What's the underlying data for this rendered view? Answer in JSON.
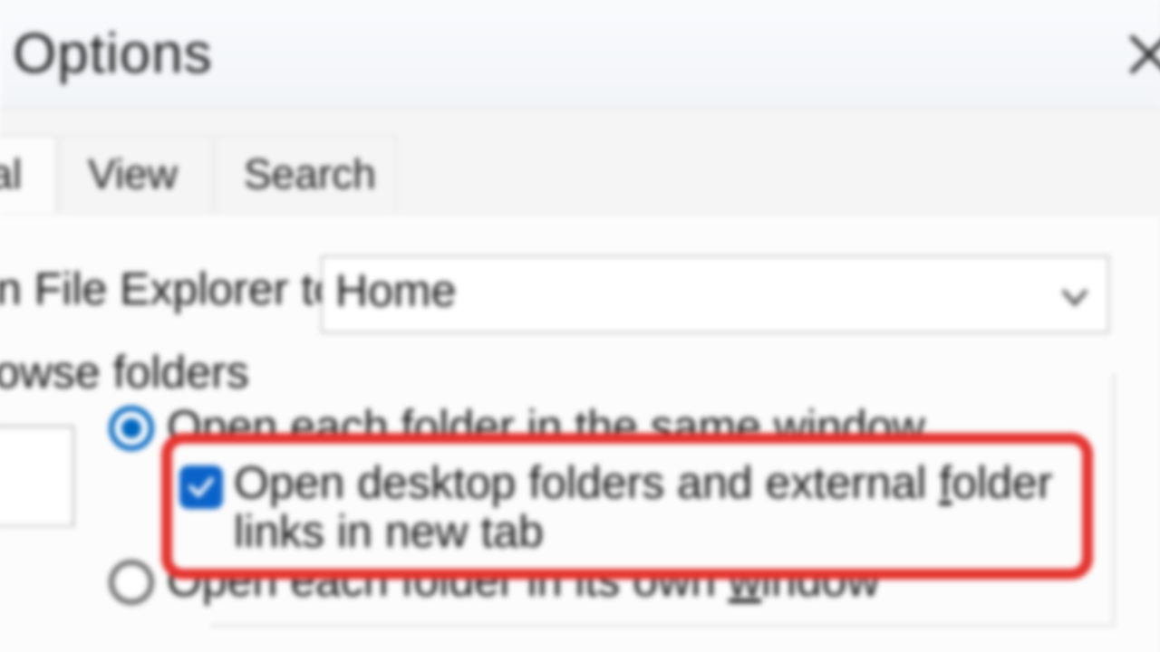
{
  "window": {
    "title": "Options"
  },
  "tabs": {
    "general": "ral",
    "view": "View",
    "search": "Search"
  },
  "open_to": {
    "label": "n File Explorer to:",
    "value": "Home"
  },
  "browse": {
    "group_label": "owse folders",
    "radio_same_pre": "Open each folder in the sa",
    "radio_same_u": "m",
    "radio_same_post": "e window",
    "checkbox_pre": "Open desktop folders and external ",
    "checkbox_u": "f",
    "checkbox_post": "older links in new tab",
    "radio_own_pre": "Open each folder in its own ",
    "radio_own_u": "w",
    "radio_own_post": "indow"
  }
}
